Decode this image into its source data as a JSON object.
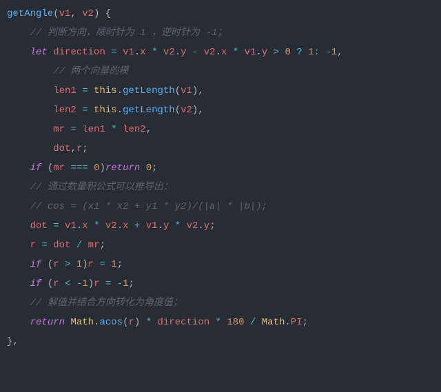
{
  "code": {
    "fn_name": "getAngle",
    "params": [
      "v1",
      "v2"
    ],
    "comment_direction": "// 判断方向，顺时针为 1 ，逆时针为 -1；",
    "kw_let": "let",
    "var_direction": "direction",
    "v1": "v1",
    "v2": "v2",
    "px": "x",
    "py": "y",
    "gt0": "0",
    "tern_1": "1",
    "tern_neg1": "-1",
    "comment_mod": "// 两个向量的模",
    "var_len1": "len1",
    "var_len2": "len2",
    "this": "this",
    "getLength": "getLength",
    "var_mr": "mr",
    "var_dot": "dot",
    "var_r": "r",
    "kw_if": "if",
    "triple_eq": "===",
    "zero": "0",
    "kw_return": "return",
    "comment_derive": "// 通过数量积公式可以推导出：",
    "comment_cos": "// cos = (x1 * x2 + y1 * y2)/(|a| * |b|);",
    "gt": ">",
    "lt": "<",
    "one": "1",
    "neg_one": "1",
    "comment_resolve": "// 解值并结合方向转化为角度值；",
    "Math": "Math",
    "acos": "acos",
    "PI": "PI",
    "n180": "180"
  }
}
